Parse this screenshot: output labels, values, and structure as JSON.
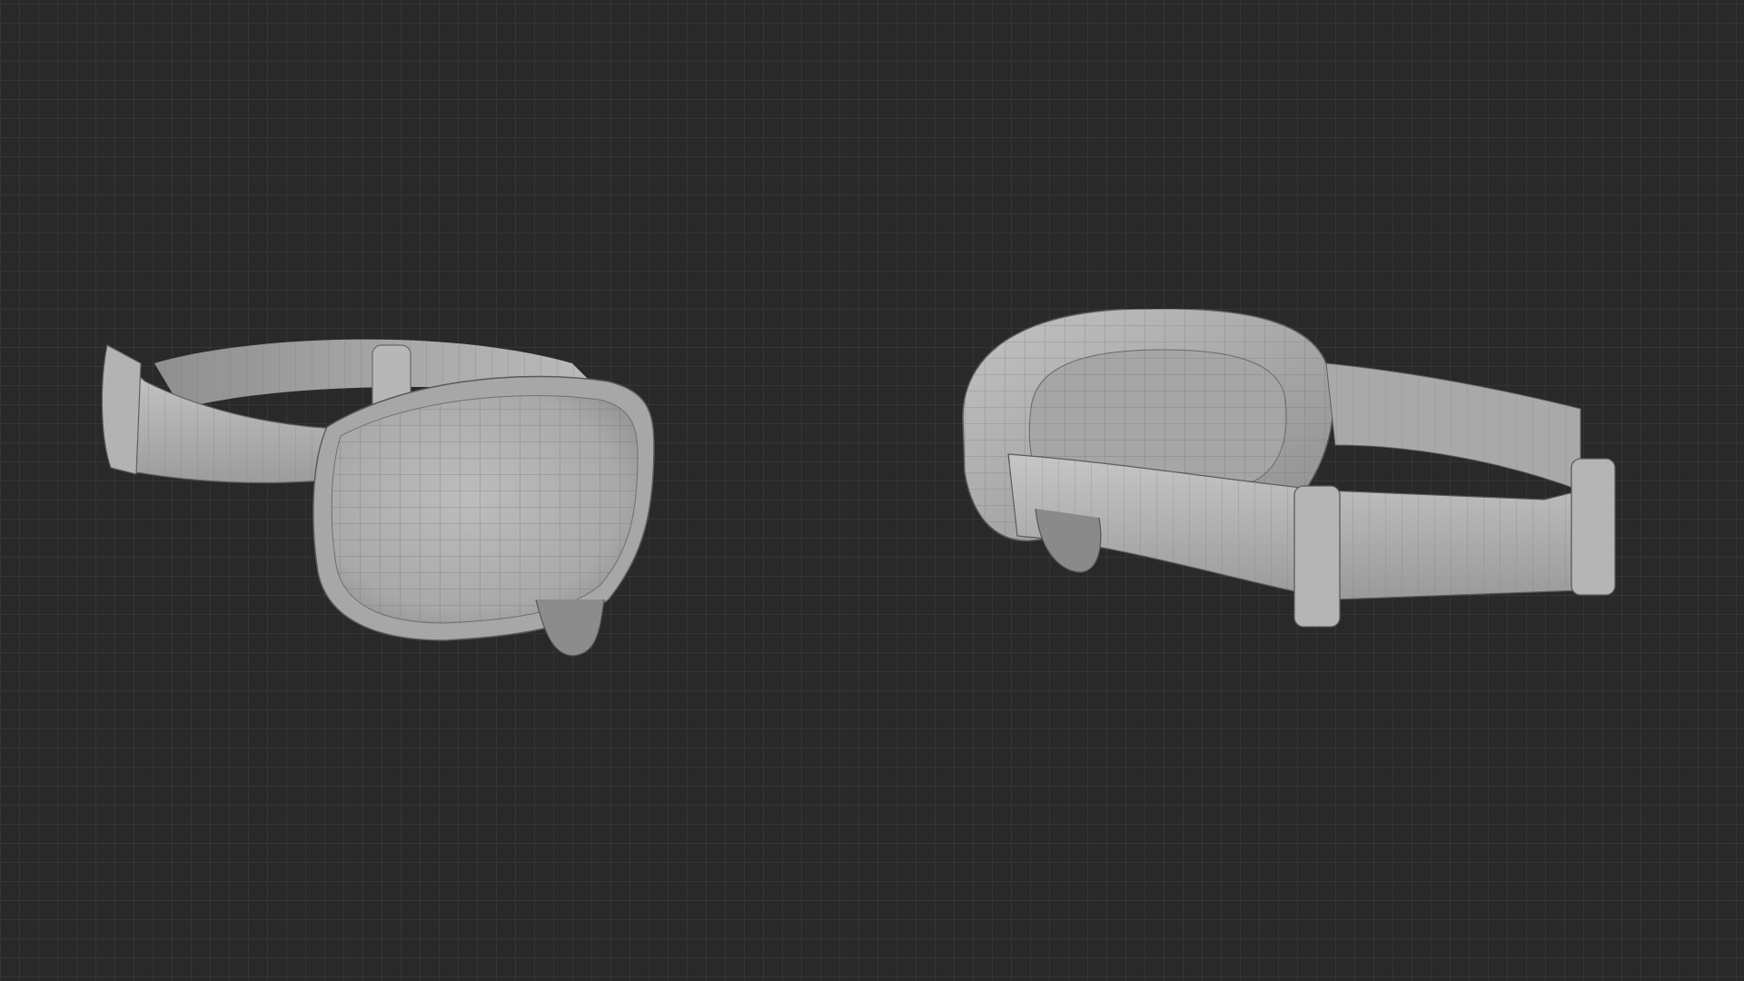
{
  "viewport": {
    "name": "3d-viewport",
    "background_color": "#292929",
    "grid_color": "#353535",
    "mesh_color": "#b9b9b9",
    "wire_color": "#6f6f6f"
  },
  "objects": [
    {
      "name": "ski-goggles-front-view",
      "icon": "goggles-model"
    },
    {
      "name": "ski-goggles-rear-view",
      "icon": "goggles-model"
    }
  ]
}
